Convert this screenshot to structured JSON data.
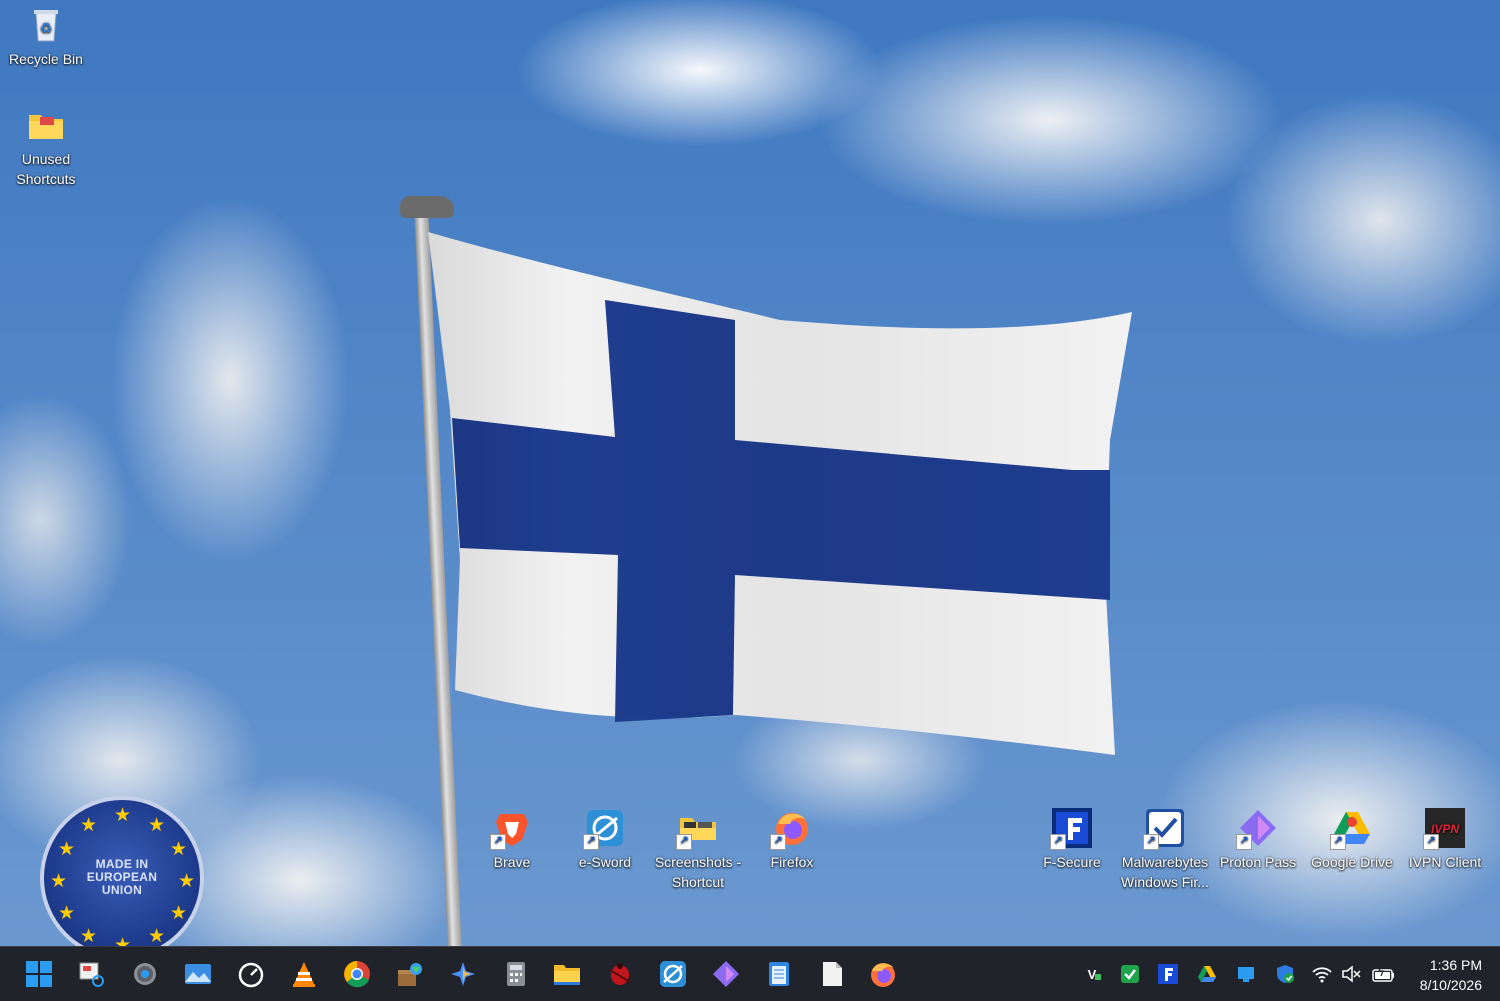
{
  "desktop": {
    "top_icons": [
      {
        "label": "Recycle Bin",
        "icon": "recycle-bin-icon"
      },
      {
        "label": "Unused Shortcuts",
        "icon": "folder-icon"
      }
    ],
    "bottom_icons": [
      {
        "label": "Brave",
        "icon": "brave-icon"
      },
      {
        "label": "e-Sword",
        "icon": "e-sword-icon"
      },
      {
        "label": "Screenshots - Shortcut",
        "icon": "screenshots-folder-icon"
      },
      {
        "label": "Firefox",
        "icon": "firefox-icon"
      },
      {
        "label": "F-Secure",
        "icon": "f-secure-icon"
      },
      {
        "label": "Malwarebytes Windows Fir...",
        "icon": "malwarebytes-firewall-icon"
      },
      {
        "label": "Proton Pass",
        "icon": "proton-pass-icon"
      },
      {
        "label": "Google Drive",
        "icon": "google-drive-icon"
      },
      {
        "label": "IVPN Client",
        "icon": "ivpn-icon"
      }
    ],
    "eu_badge": {
      "line1": "MADE IN",
      "line2": "EUROPEAN",
      "line3": "UNION"
    },
    "ivpn_logo_text": "IVPN"
  },
  "taskbar": {
    "pinned": [
      "start-icon",
      "snipping-tool-icon",
      "settings-icon",
      "photos-icon",
      "performance-gauge-icon",
      "vlc-icon",
      "chrome-icon",
      "package-icon",
      "copilot-icon",
      "calculator-icon",
      "file-explorer-icon",
      "ladybug-icon",
      "e-sword-icon",
      "proton-pass-icon",
      "notepad-icon",
      "document-icon",
      "firefox-icon"
    ],
    "tray": [
      "veeam-icon",
      "checkmark-icon",
      "f-secure-tray-icon",
      "google-drive-tray-icon",
      "windows-tray-icon",
      "defender-icon",
      "wifi-icon",
      "speaker-muted-icon",
      "battery-icon"
    ],
    "clock": {
      "time": "1:36 PM",
      "date": "8/10/2026"
    }
  },
  "colors": {
    "finland_blue": "#1f3d8f",
    "flag_white": "#f2f2f2",
    "taskbar": "#20232a"
  }
}
